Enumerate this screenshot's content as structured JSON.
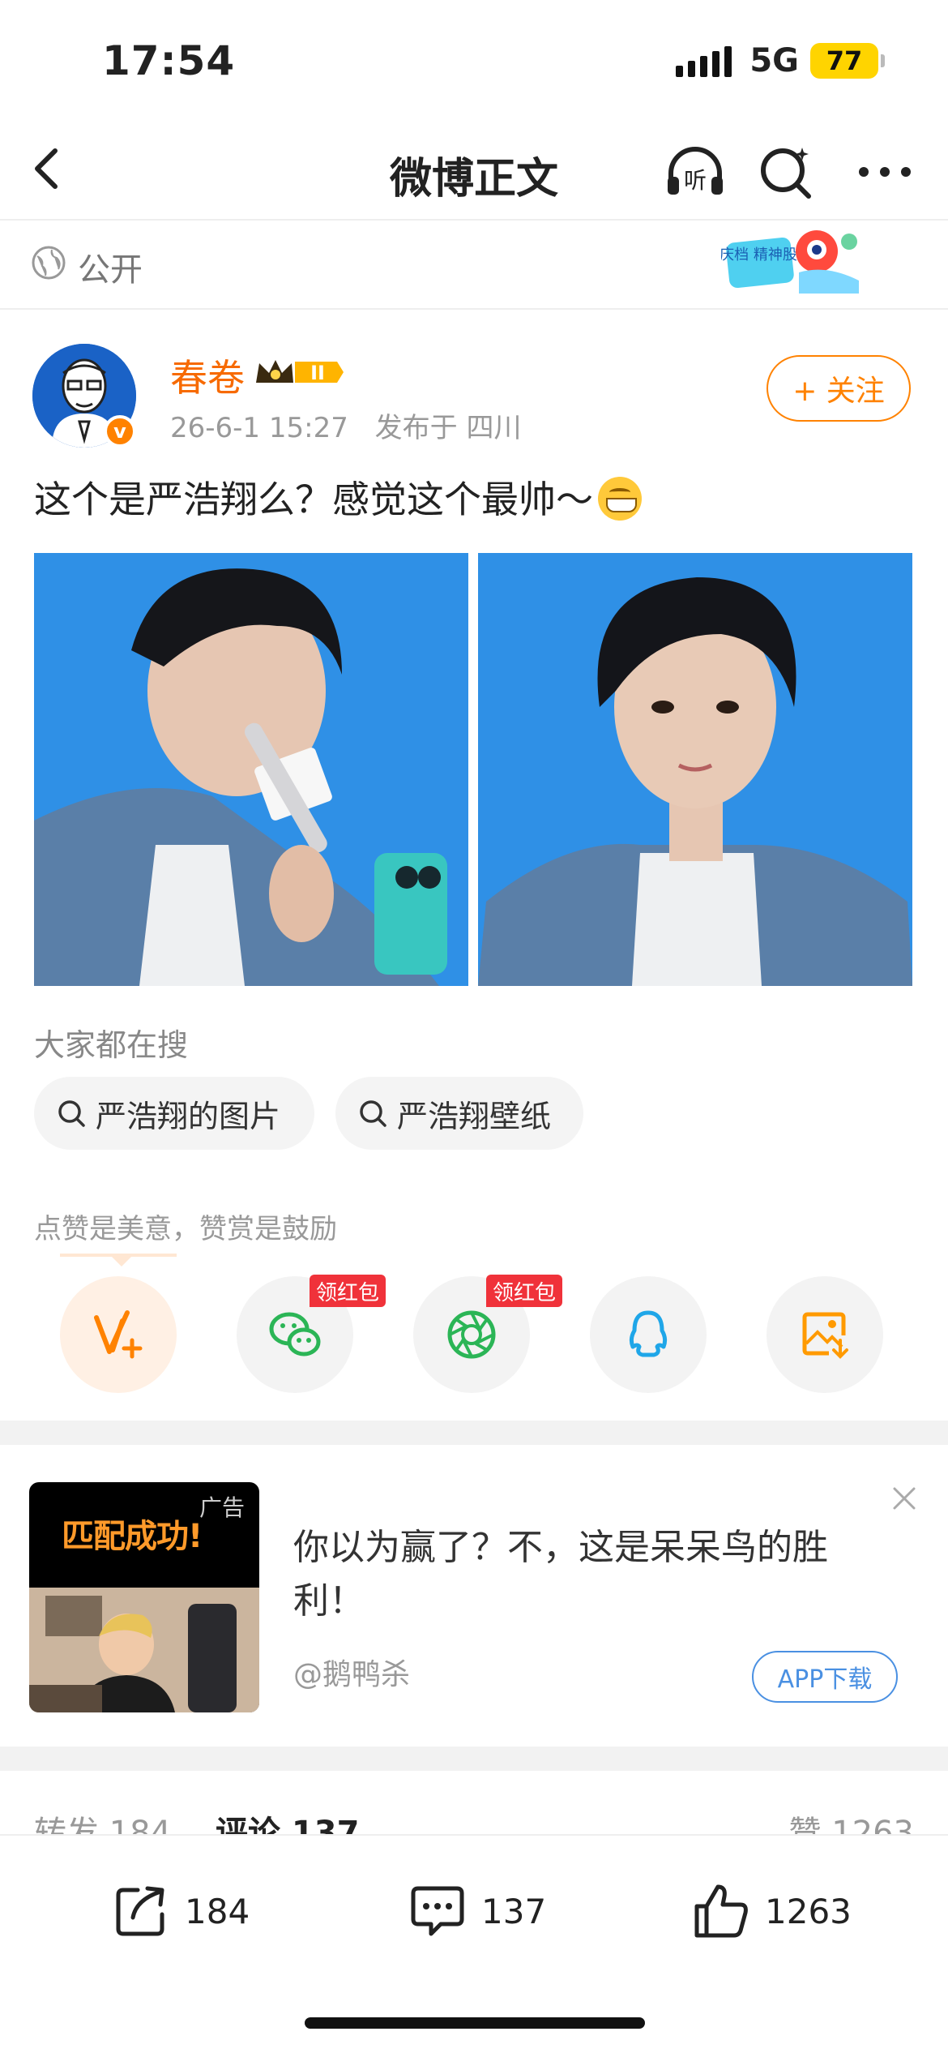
{
  "status_bar": {
    "time": "17:54",
    "network": "5G",
    "battery": "77"
  },
  "nav": {
    "title": "微博正文",
    "listen_label": "听"
  },
  "visibility": {
    "label": "公开",
    "badge_text": "国庆档 精神股东"
  },
  "post": {
    "author": "春卷",
    "level_badge": "II",
    "time": "26-6-1 15:27",
    "location": "发布于 四川",
    "follow_label": "+ 关注",
    "verified_badge": "v",
    "text": "这个是严浩翔么？感觉这个最帅～"
  },
  "searches": {
    "label": "大家都在搜",
    "chips": [
      "严浩翔的图片",
      "严浩翔壁纸"
    ]
  },
  "reward": {
    "tip": "点赞是美意，赞赏是鼓励",
    "red_tag": "领红包"
  },
  "ad": {
    "image_caption": "匹配成功!",
    "ad_tag": "广告",
    "title": "你以为赢了？不，这是呆呆鸟的胜利！",
    "source": "@鹅鸭杀",
    "button": "APP下载"
  },
  "counts": {
    "repost": "转发 184",
    "comment": "评论 137",
    "like": "赞 1263"
  },
  "bottom_bar": {
    "repost": "184",
    "comment": "137",
    "like": "1263"
  },
  "colors": {
    "accent": "#ff8200",
    "link_blue": "#4a90e2",
    "red_tag": "#f0323a"
  }
}
